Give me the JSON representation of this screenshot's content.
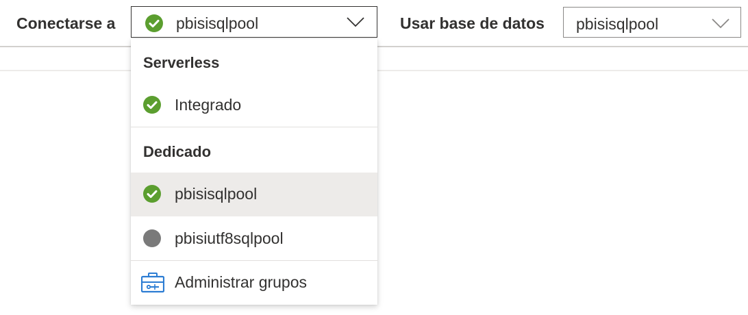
{
  "toolbar": {
    "connect_label": "Conectarse a",
    "connect_value": "pbisisqlpool",
    "database_label": "Usar base de datos",
    "database_value": "pbisisqlpool"
  },
  "dropdown": {
    "groups": [
      {
        "header": "Serverless",
        "items": [
          {
            "label": "Integrado",
            "status": "online",
            "icon": "check-circle-icon"
          }
        ]
      },
      {
        "header": "Dedicado",
        "items": [
          {
            "label": "pbisisqlpool",
            "status": "online",
            "selected": true,
            "icon": "check-circle-icon"
          },
          {
            "label": "pbisiutf8sqlpool",
            "status": "paused",
            "icon": "gray-circle-icon"
          }
        ]
      }
    ],
    "manage_label": "Administrar grupos",
    "manage_icon": "toolbox-icon"
  },
  "colors": {
    "online": "#5b9e2f",
    "paused": "#7a7a7a",
    "accent": "#2b7cd3",
    "selected_bg": "#edebe9"
  }
}
